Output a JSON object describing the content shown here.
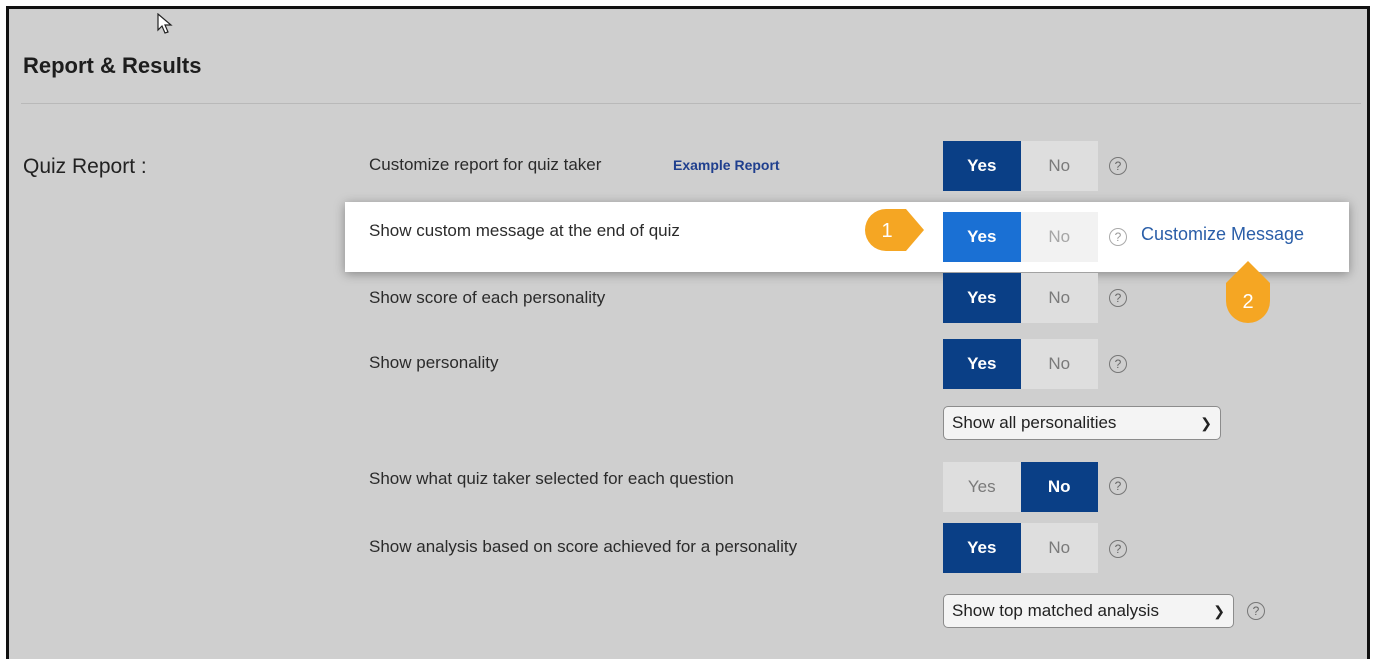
{
  "section": {
    "title": "Report & Results"
  },
  "quiz_report": {
    "label": "Quiz Report :"
  },
  "rows": [
    {
      "label": "Customize report for quiz taker",
      "link": "Example Report",
      "yes": "Yes",
      "no": "No",
      "selected": "Yes"
    },
    {
      "label": "Show custom message at the end of quiz",
      "yes": "Yes",
      "no": "No",
      "selected": "Yes",
      "action": "Customize Message"
    },
    {
      "label": "Show score of each personality",
      "yes": "Yes",
      "no": "No",
      "selected": "Yes"
    },
    {
      "label": "Show personality",
      "yes": "Yes",
      "no": "No",
      "selected": "Yes"
    },
    {
      "label": "Show what quiz taker selected for each question",
      "yes": "Yes",
      "no": "No",
      "selected": "No"
    },
    {
      "label": "Show analysis based on score achieved for a personality",
      "yes": "Yes",
      "no": "No",
      "selected": "Yes"
    }
  ],
  "dropdowns": {
    "personality": {
      "value": "Show all personalities"
    },
    "analysis": {
      "value": "Show top matched analysis"
    }
  },
  "markers": [
    {
      "number": "1"
    },
    {
      "number": "2"
    }
  ],
  "icons": {
    "help": "question-circle-icon",
    "cursor": "mouse-cursor-icon",
    "caret": "chevron-down-icon"
  },
  "colors": {
    "toggle_on": "#0a3f86",
    "toggle_on_highlight": "#1a70d4",
    "marker": "#f5a623",
    "link": "#1f3f8e"
  }
}
